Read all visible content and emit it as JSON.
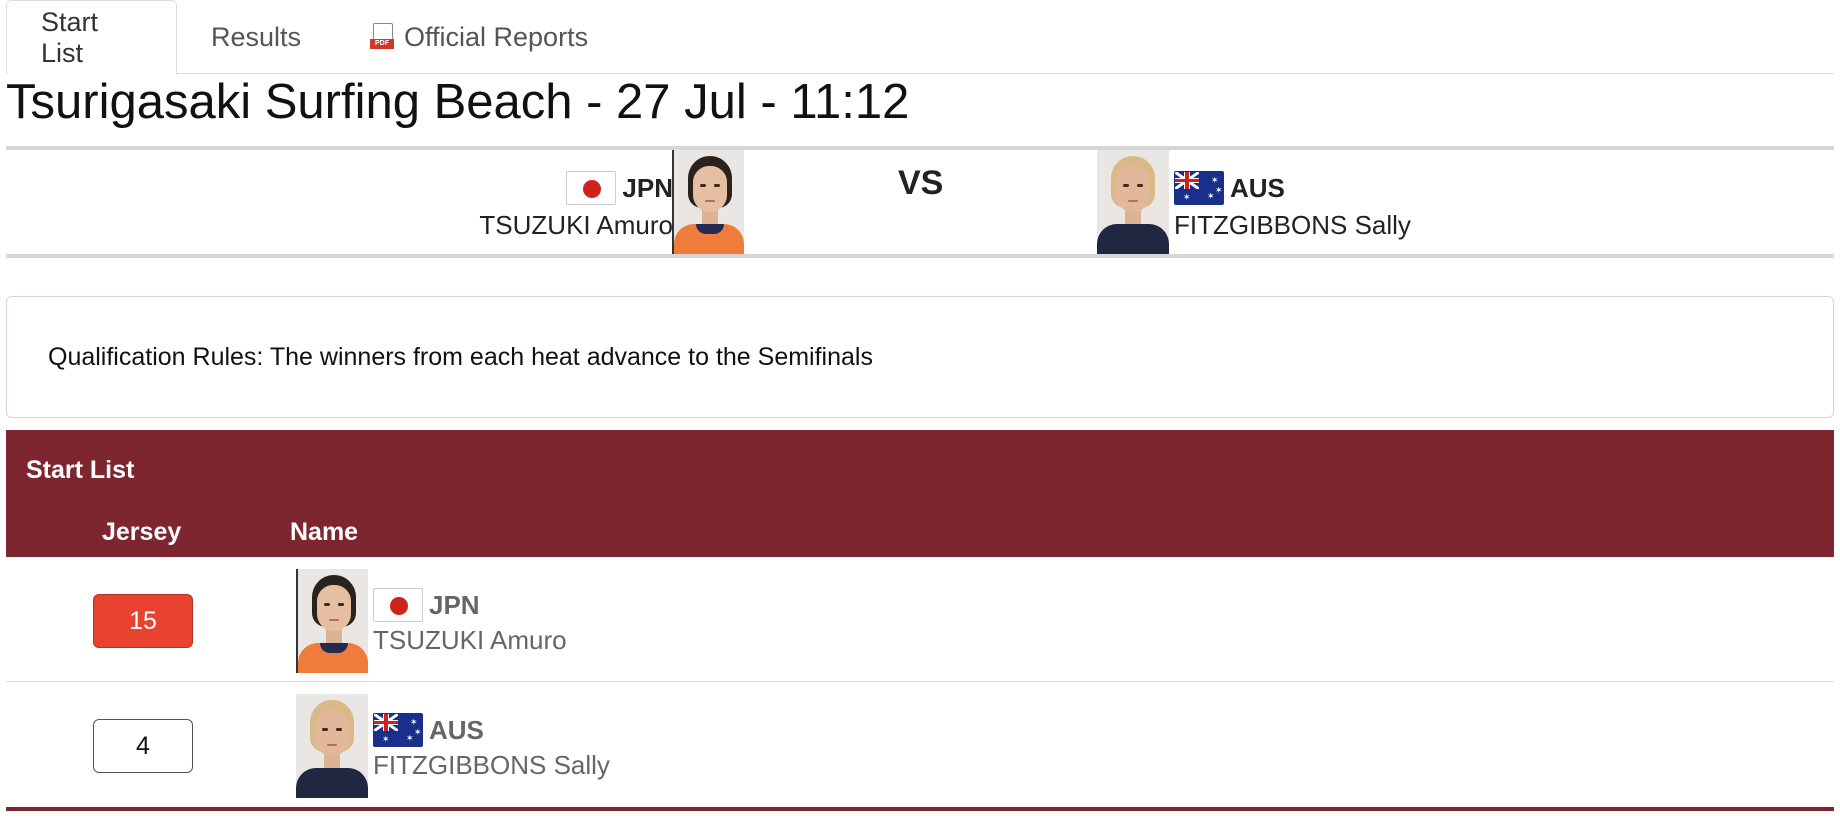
{
  "tabs": [
    {
      "label": "Start List",
      "active": true
    },
    {
      "label": "Results",
      "active": false
    },
    {
      "label": "Official Reports",
      "active": false,
      "icon": "pdf-icon"
    }
  ],
  "pdf_icon_text": "PDF",
  "page_title": "Tsurigasaki Surfing Beach - 27 Jul - 11:12",
  "matchup": {
    "left": {
      "code": "JPN",
      "name": "TSUZUKI Amuro",
      "flag": "flag-jpn"
    },
    "vs_label": "VS",
    "right": {
      "code": "AUS",
      "name": "FITZGIBBONS Sally",
      "flag": "flag-aus"
    }
  },
  "qualification_rules": "Qualification Rules: The winners from each heat advance to the Semifinals",
  "start_list": {
    "title": "Start List",
    "columns": {
      "jersey": "Jersey",
      "name": "Name"
    },
    "rows": [
      {
        "jersey": "15",
        "jersey_color": "#e8432e",
        "code": "JPN",
        "name": "TSUZUKI Amuro"
      },
      {
        "jersey": "4",
        "jersey_color": "#ffffff",
        "code": "AUS",
        "name": "FITZGIBBONS Sally"
      }
    ]
  },
  "colors": {
    "header_bg": "#7e2630",
    "jersey_red": "#e8432e",
    "jpn_flag_red": "#d0221b",
    "aus_flag_blue": "#1a2e8c"
  }
}
